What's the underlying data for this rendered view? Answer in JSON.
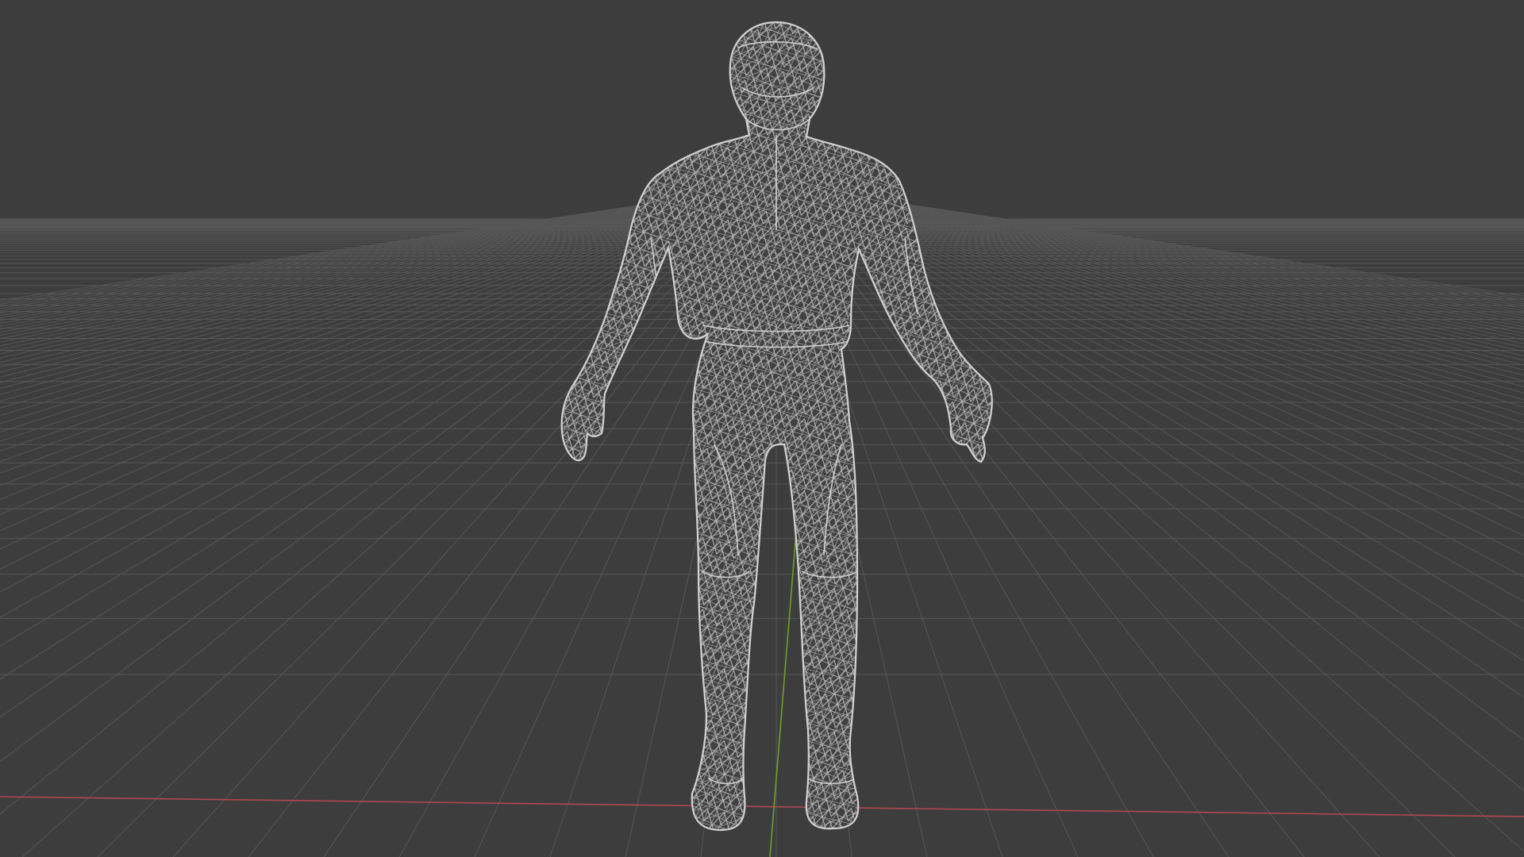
{
  "viewport": {
    "background_color": "#3d3d3d",
    "grid_color": "#565656",
    "x_axis_color": "#b24653",
    "y_axis_color": "#6f9f2c",
    "wireframe_color": "#c9c9c9",
    "object": "humanoid-wireframe-mesh",
    "shading": "wireframe",
    "grid_visible": true,
    "axes_visible": [
      "X",
      "Y"
    ]
  }
}
